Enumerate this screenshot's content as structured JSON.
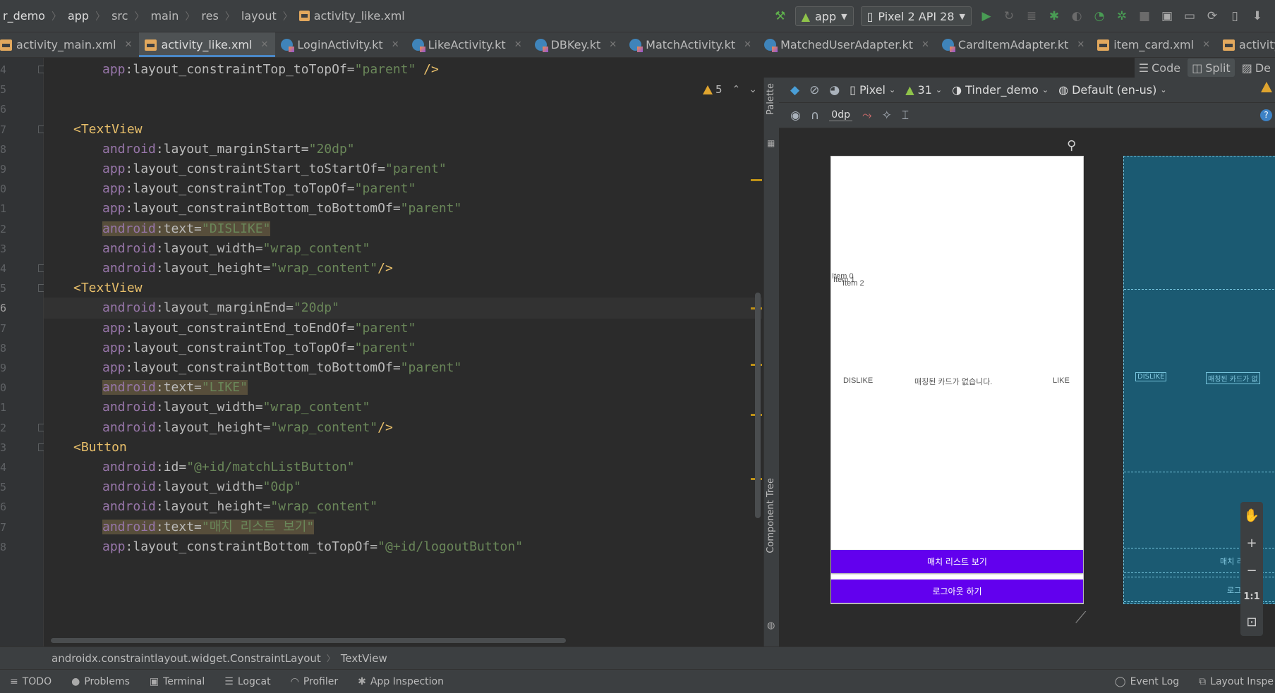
{
  "navbar": {
    "crumbs": [
      "r_demo",
      "app",
      "src",
      "main",
      "res",
      "layout",
      "activity_like.xml"
    ],
    "run_config": "app",
    "device": "Pixel 2 API 28"
  },
  "tabs": [
    {
      "label": "activity_main.xml",
      "type": "xml",
      "active": false
    },
    {
      "label": "activity_like.xml",
      "type": "xml",
      "active": true
    },
    {
      "label": "LoginActivity.kt",
      "type": "kt",
      "active": false
    },
    {
      "label": "LikeActivity.kt",
      "type": "kt",
      "active": false
    },
    {
      "label": "DBKey.kt",
      "type": "kt",
      "active": false
    },
    {
      "label": "MatchActivity.kt",
      "type": "kt",
      "active": false
    },
    {
      "label": "MatchedUserAdapter.kt",
      "type": "kt",
      "active": false
    },
    {
      "label": "CardItemAdapter.kt",
      "type": "kt",
      "active": false
    },
    {
      "label": "item_card.xml",
      "type": "xml",
      "active": false
    },
    {
      "label": "activity_login.xml",
      "type": "xml",
      "active": false
    }
  ],
  "view_modes": {
    "code": "Code",
    "split": "Split",
    "design": "De"
  },
  "editor": {
    "warning_count": "5",
    "line_numbers": [
      "4",
      "5",
      "6",
      "7",
      "8",
      "9",
      "0",
      "1",
      "2",
      "3",
      "4",
      "5",
      "6",
      "7",
      "8",
      "9",
      "0",
      "1",
      "2",
      "3",
      "4",
      "5",
      "6",
      "7",
      "8"
    ],
    "lines": [
      {
        "ns": "app",
        "attr": ":layout_constraintTop_toTopOf",
        "eq": "=",
        "val": "\"parent\"",
        "end": " />"
      },
      {},
      {},
      {
        "tag": "<TextView"
      },
      {
        "ns": "android",
        "attr": ":layout_marginStart",
        "eq": "=",
        "val": "\"20dp\""
      },
      {
        "ns": "app",
        "attr": ":layout_constraintStart_toStartOf",
        "eq": "=",
        "val": "\"parent\""
      },
      {
        "ns": "app",
        "attr": ":layout_constraintTop_toTopOf",
        "eq": "=",
        "val": "\"parent\""
      },
      {
        "ns": "app",
        "attr": ":layout_constraintBottom_toBottomOf",
        "eq": "=",
        "val": "\"parent\""
      },
      {
        "ns": "android",
        "attr": ":text",
        "eq": "=",
        "val": "\"DISLIKE\"",
        "hl": true
      },
      {
        "ns": "android",
        "attr": ":layout_width",
        "eq": "=",
        "val": "\"wrap_content\""
      },
      {
        "ns": "android",
        "attr": ":layout_height",
        "eq": "=",
        "val": "\"wrap_content\"",
        "end": "/>"
      },
      {
        "tag": "<TextView"
      },
      {
        "ns": "android",
        "attr": ":layout_marginEnd",
        "eq": "=",
        "val": "\"20dp\""
      },
      {
        "ns": "app",
        "attr": ":layout_constraintEnd_toEndOf",
        "eq": "=",
        "val": "\"parent\""
      },
      {
        "ns": "app",
        "attr": ":layout_constraintTop_toTopOf",
        "eq": "=",
        "val": "\"parent\""
      },
      {
        "ns": "app",
        "attr": ":layout_constraintBottom_toBottomOf",
        "eq": "=",
        "val": "\"parent\""
      },
      {
        "ns": "android",
        "attr": ":text",
        "eq": "=",
        "val": "\"LIKE\"",
        "hl": true
      },
      {
        "ns": "android",
        "attr": ":layout_width",
        "eq": "=",
        "val": "\"wrap_content\""
      },
      {
        "ns": "android",
        "attr": ":layout_height",
        "eq": "=",
        "val": "\"wrap_content\"",
        "end": "/>"
      },
      {
        "tag": "<Button"
      },
      {
        "ns": "android",
        "attr": ":id",
        "eq": "=",
        "val": "\"@+id/matchListButton\""
      },
      {
        "ns": "android",
        "attr": ":layout_width",
        "eq": "=",
        "val": "\"0dp\""
      },
      {
        "ns": "android",
        "attr": ":layout_height",
        "eq": "=",
        "val": "\"wrap_content\""
      },
      {
        "ns": "android",
        "attr": ":text",
        "eq": "=",
        "val": "\"매치 리스트 보기\"",
        "hl": true
      },
      {
        "ns": "app",
        "attr": ":layout_constraintBottom_toTopOf",
        "eq": "=",
        "val": "\"@+id/logoutButton\""
      }
    ]
  },
  "side_labels": {
    "palette": "Palette",
    "component_tree": "Component Tree"
  },
  "designer": {
    "device": "Pixel",
    "api": "31",
    "theme": "Tinder_demo",
    "locale": "Default (en-us)",
    "margin": "0dp",
    "preview": {
      "list_items": [
        "Item 0",
        "Item 1",
        "Item 2"
      ],
      "dislike": "DISLIKE",
      "empty_message": "매칭된 카드가 없습니다.",
      "like": "LIKE",
      "match_list_button": "매치 리스트 보기",
      "logout_button": "로그아웃 하기"
    },
    "blueprint": {
      "dislike": "DISLIKE",
      "empty_message": "매칭된 카드가 없",
      "match_btn": "매치 리",
      "logout_btn": "로그"
    },
    "zoom_fit": "1:1"
  },
  "status": {
    "breadcrumb": [
      "androidx.constraintlayout.widget.ConstraintLayout",
      "TextView"
    ]
  },
  "toolwindows": {
    "left": [
      "TODO",
      "Problems",
      "Terminal",
      "Logcat",
      "Profiler",
      "App Inspection"
    ],
    "right": [
      "Event Log",
      "Layout Inspe"
    ]
  }
}
